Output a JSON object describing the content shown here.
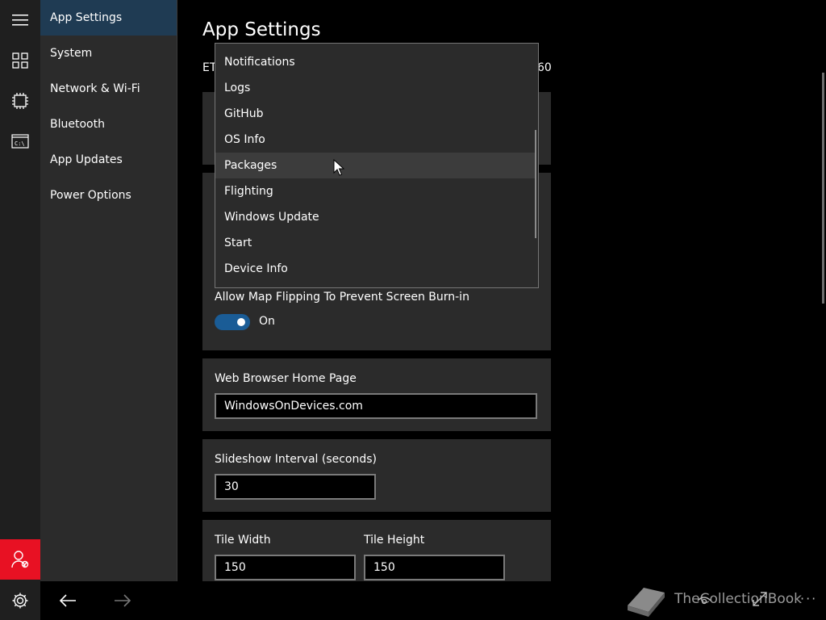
{
  "page": {
    "title": "App Settings",
    "ethernet_left": "ET",
    "ethernet_right": "60"
  },
  "nav": {
    "items": [
      {
        "label": "App Settings",
        "selected": true
      },
      {
        "label": "System"
      },
      {
        "label": "Network & Wi-Fi"
      },
      {
        "label": "Bluetooth"
      },
      {
        "label": "App Updates"
      },
      {
        "label": "Power Options"
      }
    ]
  },
  "rail": {
    "icons": [
      "hamburger-icon",
      "tiles-icon",
      "chip-icon",
      "console-icon",
      "user-icon"
    ],
    "user_color": "#e81123"
  },
  "dropdown": {
    "items": [
      {
        "label": "Notifications"
      },
      {
        "label": "Logs"
      },
      {
        "label": "GitHub"
      },
      {
        "label": "OS Info"
      },
      {
        "label": "Packages",
        "hovered": true
      },
      {
        "label": "Flighting"
      },
      {
        "label": "Windows Update"
      },
      {
        "label": "Start"
      },
      {
        "label": "Device Info"
      }
    ]
  },
  "map_flip": {
    "label": "Allow Map Flipping To Prevent Screen Burn-in",
    "state": "On",
    "accent": "#1a5c96"
  },
  "browser": {
    "label": "Web Browser Home Page",
    "value": "WindowsOnDevices.com"
  },
  "slideshow": {
    "label": "Slideshow Interval (seconds)",
    "value": "30"
  },
  "tile": {
    "width_label": "Tile Width",
    "width_value": "150",
    "height_label": "Tile Height",
    "height_value": "150"
  },
  "watermark": {
    "text": "TheCollectionBook"
  }
}
